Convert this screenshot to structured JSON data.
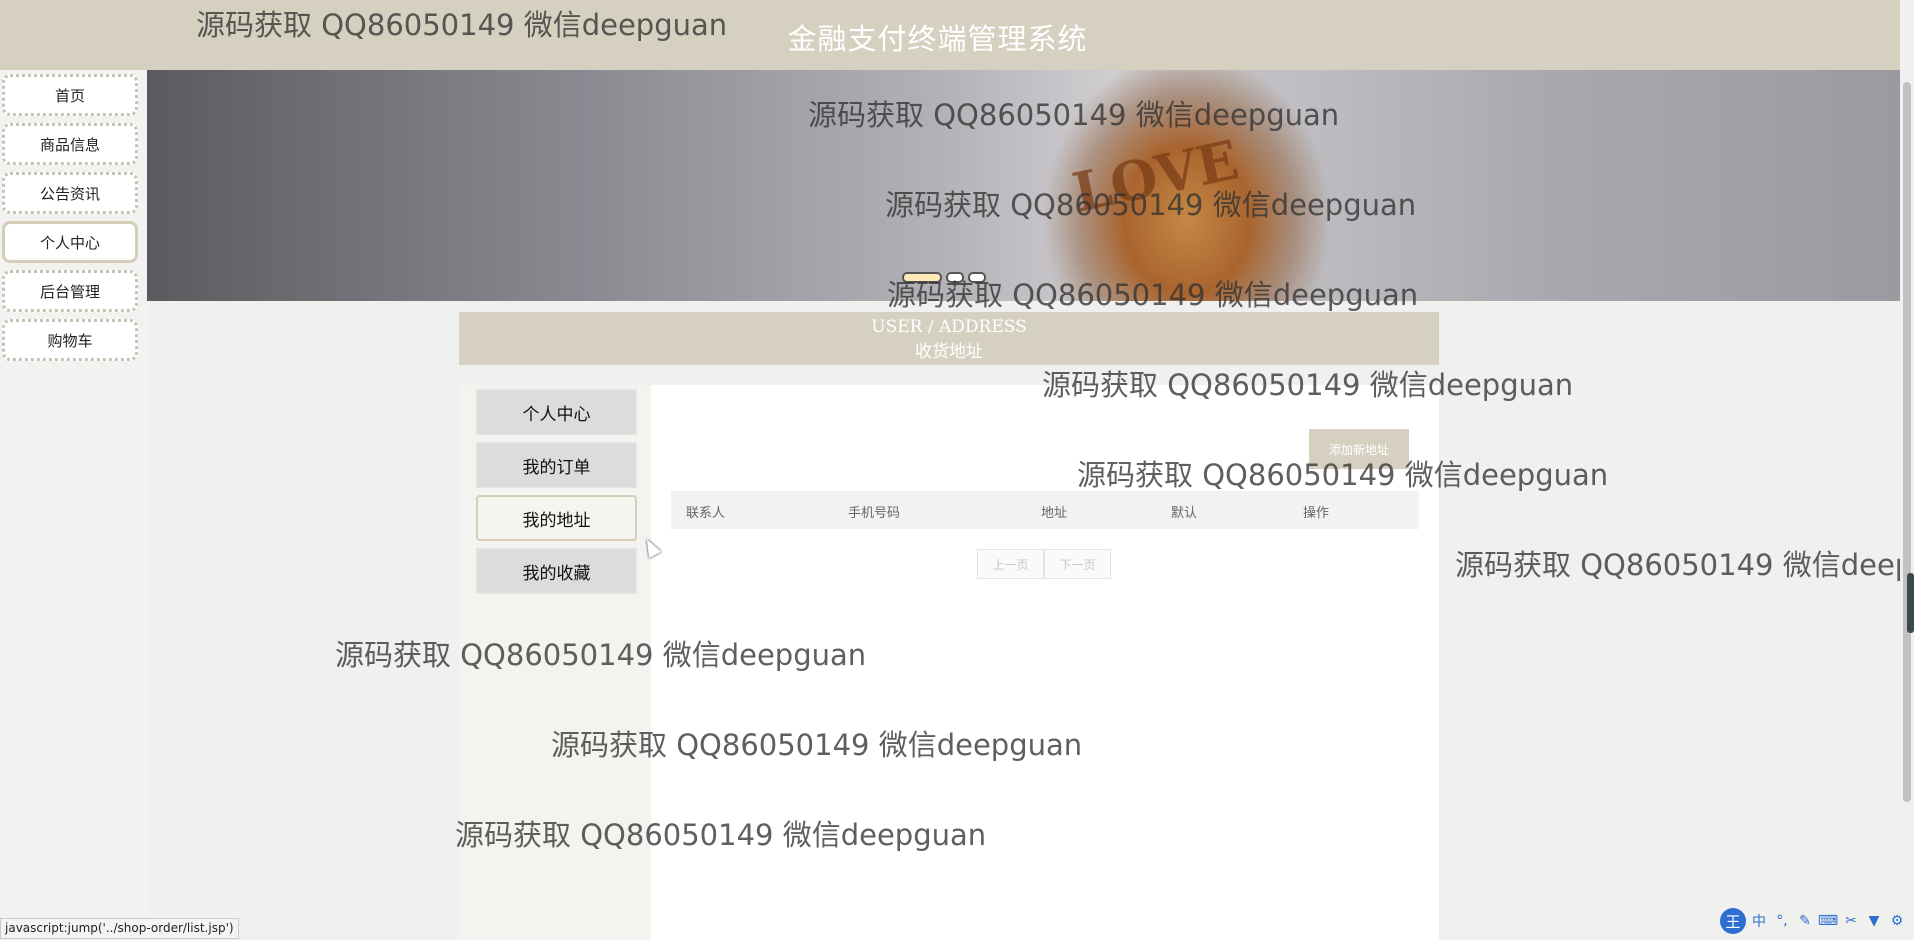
{
  "site": {
    "title": "金融支付终端管理系统"
  },
  "nav": {
    "items": [
      {
        "label": "首页"
      },
      {
        "label": "商品信息"
      },
      {
        "label": "公告资讯"
      },
      {
        "label": "个人中心"
      },
      {
        "label": "后台管理"
      },
      {
        "label": "购物车"
      }
    ],
    "active": "个人中心"
  },
  "banner": {
    "text": "LOVE"
  },
  "section": {
    "title_en": "USER / ADDRESS",
    "title_cn": "收货地址"
  },
  "side_menu": {
    "items": [
      {
        "label": "个人中心"
      },
      {
        "label": "我的订单"
      },
      {
        "label": "我的地址"
      },
      {
        "label": "我的收藏"
      }
    ],
    "active": "我的地址"
  },
  "address": {
    "add_button": "添加新地址",
    "columns": [
      "联系人",
      "手机号码",
      "地址",
      "默认",
      "操作"
    ],
    "rows": []
  },
  "pager": {
    "prev": "上一页",
    "next": "下一页"
  },
  "watermark": "源码获取 QQ86050149 微信deepguan",
  "status_bar": "javascript:jump('../shop-order/list.jsp')",
  "ime": {
    "logo": "王",
    "mode": "中"
  },
  "colors": {
    "accent": "#d6d0c1",
    "active_border": "#d6ceb9",
    "ime": "#2d6fd1"
  }
}
